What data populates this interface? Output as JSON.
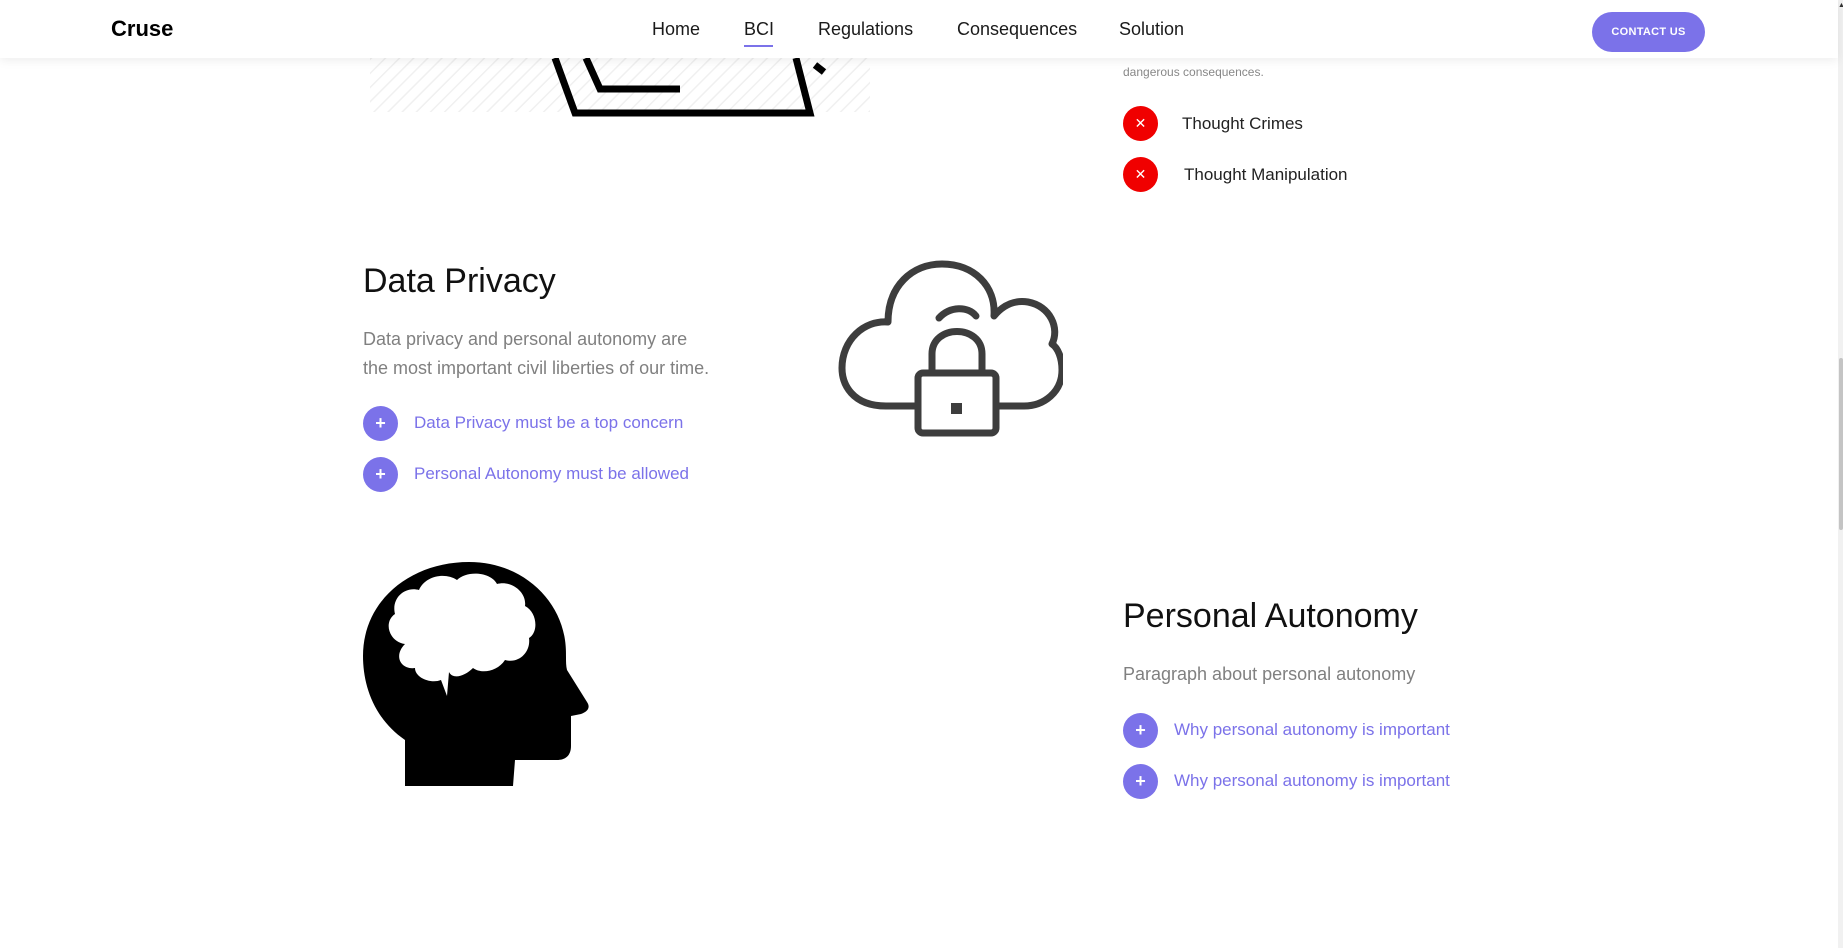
{
  "header": {
    "brand": "Cruse",
    "nav": {
      "home": "Home",
      "bci": "BCI",
      "regulations": "Regulations",
      "consequences": "Consequences",
      "solution": "Solution"
    },
    "contact": "CONTACT US",
    "active_tab": "BCI"
  },
  "top_section": {
    "caption": "dangerous consequences.",
    "items": [
      "Thought Crimes",
      "Thought Manipulation"
    ],
    "item_icon": "x-icon",
    "item_color": "#f00000"
  },
  "data_privacy": {
    "title": "Data Privacy",
    "paragraph_line1": "Data privacy and personal autonomy are",
    "paragraph_line2": "the most important civil liberties of our time.",
    "items": [
      "Data Privacy must be a top concern",
      "Personal Autonomy must be allowed"
    ],
    "item_icon": "plus-icon",
    "illustration": "cloud-lock-icon"
  },
  "personal_autonomy": {
    "title": "Personal Autonomy",
    "paragraph": "Paragraph about personal autonomy",
    "items": [
      "Why personal autonomy is important",
      "Why personal autonomy is important"
    ],
    "item_icon": "plus-icon",
    "illustration": "head-brain-icon"
  },
  "colors": {
    "accent": "#7b72e9",
    "danger": "#f00000",
    "text": "#111111",
    "muted": "#808080"
  }
}
